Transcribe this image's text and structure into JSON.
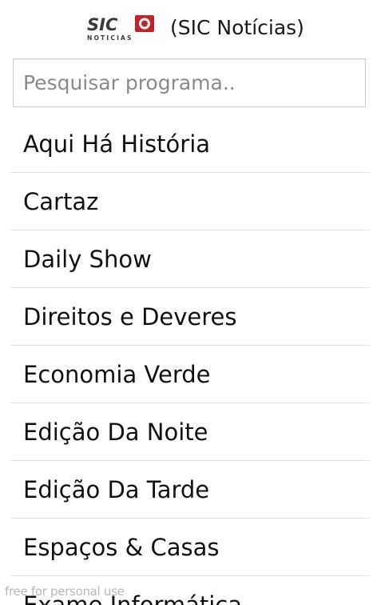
{
  "header": {
    "logo_text_top": "SIC",
    "logo_text_bottom": "NOTICIAS",
    "channel_title": "(SIC Notícias)"
  },
  "search": {
    "placeholder": "Pesquisar programa..",
    "value": ""
  },
  "programs": [
    "Aqui Há História",
    "Cartaz",
    "Daily Show",
    "Direitos e Deveres",
    "Economia Verde",
    "Edição Da Noite",
    "Edição Da Tarde",
    "Espaços & Casas",
    "Exame Informática"
  ],
  "watermark": "free for personal use",
  "colors": {
    "logo_dark": "#3a3a3a",
    "logo_red": "#c8202a",
    "divider": "#e3e3e3",
    "text": "#111111"
  }
}
